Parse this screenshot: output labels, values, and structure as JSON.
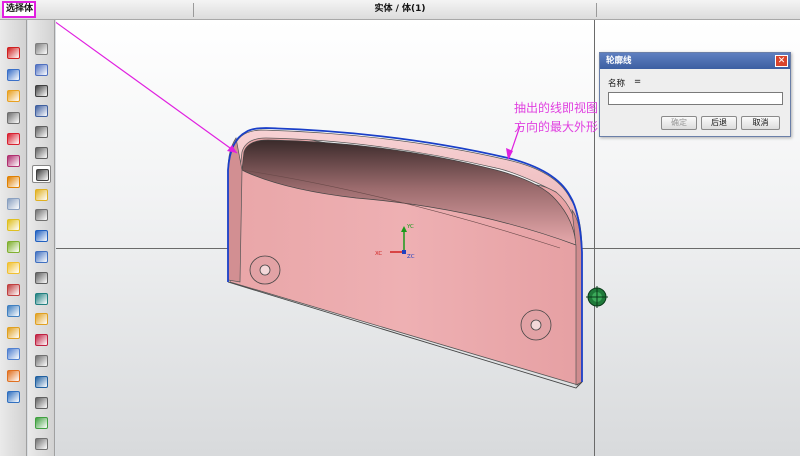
{
  "header": {
    "selection_label": "选择体",
    "window_title": "实体 / 体(1)"
  },
  "toolbar_left": {
    "items": [
      {
        "icon": "block-icon",
        "color": "#d02020"
      },
      {
        "icon": "cylinder-icon",
        "color": "#3a70c8"
      },
      {
        "icon": "union-icon",
        "color": "#e8a020"
      },
      {
        "icon": "sketch-icon",
        "color": "#707070"
      },
      {
        "icon": "cube-icon",
        "color": "#d82030"
      },
      {
        "icon": "datum-plane-icon",
        "color": "#b03070"
      },
      {
        "icon": "extrude-icon",
        "color": "#e08000"
      },
      {
        "icon": "blend-icon",
        "color": "#8aa0c0"
      },
      {
        "icon": "chamfer-icon",
        "color": "#e0c020"
      },
      {
        "icon": "fillet-icon",
        "color": "#80b030"
      },
      {
        "icon": "shell-icon",
        "color": "#f0c030"
      },
      {
        "icon": "hole-icon",
        "color": "#c04040"
      },
      {
        "icon": "thicken-icon",
        "color": "#4080c0"
      },
      {
        "icon": "pattern-icon",
        "color": "#e0a020"
      },
      {
        "icon": "mirror-icon",
        "color": "#5080d0"
      },
      {
        "icon": "trim-icon",
        "color": "#e07020"
      },
      {
        "icon": "split-icon",
        "color": "#3070c0"
      }
    ]
  },
  "toolbar_right": {
    "items": [
      {
        "icon": "document-icon",
        "color": "#808080"
      },
      {
        "icon": "grid-icon",
        "color": "#5070c0"
      },
      {
        "icon": "axes-icon",
        "color": "#404040"
      },
      {
        "icon": "measure-icon",
        "color": "#4060a0"
      },
      {
        "icon": "view-icon",
        "color": "#606060"
      },
      {
        "icon": "frame-icon",
        "color": "#606060"
      },
      {
        "icon": "tools-icon",
        "color": "#404040",
        "active": true
      },
      {
        "icon": "layers-icon",
        "color": "#e0b020"
      },
      {
        "icon": "table-icon",
        "color": "#707070"
      },
      {
        "icon": "dimension-icon",
        "color": "#2060c0"
      },
      {
        "icon": "section-icon",
        "color": "#4070c0"
      },
      {
        "icon": "ruler-icon",
        "color": "#606060"
      },
      {
        "icon": "paint-icon",
        "color": "#208080"
      },
      {
        "icon": "stairs-icon",
        "color": "#e0a020"
      },
      {
        "icon": "gear-icon",
        "color": "#c02040"
      },
      {
        "icon": "snap-icon",
        "color": "#707070"
      },
      {
        "icon": "route-icon",
        "color": "#2060a0"
      },
      {
        "icon": "crosshair-icon",
        "color": "#606060"
      },
      {
        "icon": "check-icon",
        "color": "#40a040"
      },
      {
        "icon": "box-icon",
        "color": "#707070"
      }
    ]
  },
  "viewport": {
    "axis_labels": {
      "x": "XC",
      "y": "YC",
      "z": "ZC"
    },
    "annotation": [
      "抽出的线即视图",
      "方向的最大外形"
    ]
  },
  "dialog": {
    "title": "轮廓线",
    "name_label": "名称",
    "name_eq": "=",
    "name_value": "",
    "ok_label": "确定",
    "back_label": "后退",
    "cancel_label": "取消"
  },
  "colors": {
    "part_fill": "#eba7a7",
    "outline": "#1a3fc8",
    "annotation": "#e040e0"
  }
}
